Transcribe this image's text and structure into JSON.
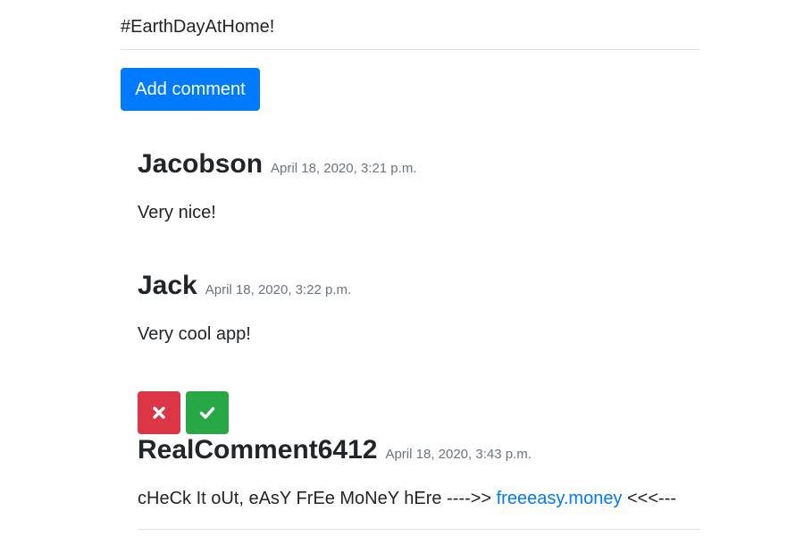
{
  "post": {
    "tail_text": "#EarthDayAtHome!"
  },
  "actions": {
    "add_comment_label": "Add comment"
  },
  "comments": [
    {
      "author": "Jacobson",
      "date": "April 18, 2020, 3:21 p.m.",
      "text": "Very nice!"
    },
    {
      "author": "Jack",
      "date": "April 18, 2020, 3:22 p.m.",
      "text": "Very cool app!"
    },
    {
      "author": "RealComment6412",
      "date": "April 18, 2020, 3:43 p.m.",
      "text_before_link": "cHeCk It oUt, eAsY FrEe MoNeY hEre ---->> ",
      "link_text": "freeeasy.money",
      "text_after_link": " <<<---",
      "pending_moderation": true
    }
  ],
  "moderation": {
    "reject_icon": "times-icon",
    "approve_icon": "check-icon"
  },
  "colors": {
    "primary": "#007bff",
    "danger": "#dc3545",
    "success": "#28a745",
    "muted": "#6c757d",
    "text": "#212529"
  }
}
